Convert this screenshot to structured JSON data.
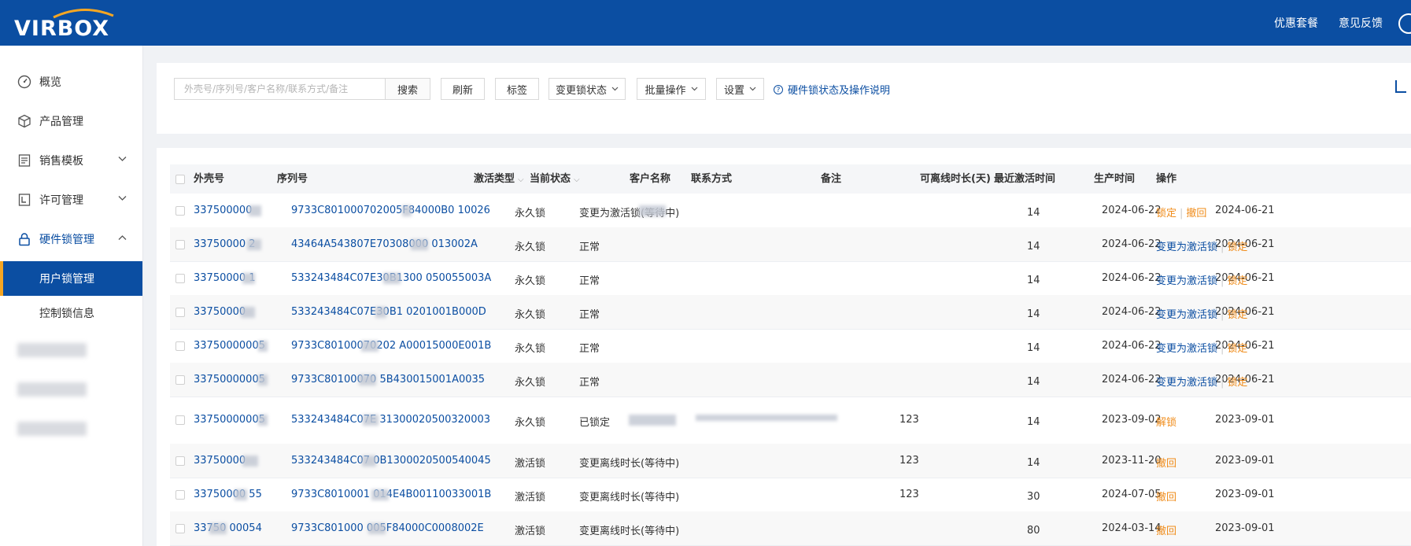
{
  "header": {
    "logo": "VIRBOX",
    "links": [
      "优惠套餐",
      "意见反馈"
    ]
  },
  "sidebar": {
    "items": [
      {
        "label": "概览",
        "icon": "dashboard-icon"
      },
      {
        "label": "产品管理",
        "icon": "cube-icon"
      },
      {
        "label": "销售模板",
        "icon": "template-icon"
      },
      {
        "label": "许可管理",
        "icon": "license-icon"
      },
      {
        "label": "硬件锁管理",
        "icon": "lock-icon"
      }
    ],
    "submenu": [
      "用户锁管理",
      "控制锁信息"
    ]
  },
  "toolbar": {
    "search_placeholder": "外壳号/序列号/客户名称/联系方式/备注",
    "search_btn": "搜索",
    "refresh_btn": "刷新",
    "tag_btn": "标签",
    "change_state_btn": "变更锁状态",
    "batch_btn": "批量操作",
    "settings_btn": "设置",
    "help_link": "硬件锁状态及操作说明"
  },
  "table": {
    "headers": {
      "shell": "外壳号",
      "serial": "序列号",
      "type": "激活类型",
      "state": "当前状态",
      "customer": "客户名称",
      "contact": "联系方式",
      "note": "备注",
      "offline": "可离线时长(天)",
      "last_active": "最近激活时间",
      "produced": "生产时间",
      "ops": "操作"
    },
    "rows": [
      {
        "shell": "337500000",
        "serial": "9733C801000702005F84000B0   10026",
        "type": "永久锁",
        "state": "变更为激活锁(等待中)",
        "note": "",
        "offline": "14",
        "last_active": "2024-06-22",
        "produced": "2024-06-21",
        "op1": "锁定",
        "op2": "撤回",
        "op1_color": "orange",
        "op2_color": "orange"
      },
      {
        "shell": "33750000   2",
        "serial": "43464A543807E70308000    013002A",
        "type": "永久锁",
        "state": "正常",
        "note": "",
        "offline": "14",
        "last_active": "2024-06-22",
        "produced": "2024-06-21",
        "op1": "变更为激活锁",
        "op2": "锁定",
        "op1_color": "link",
        "op2_color": "orange"
      },
      {
        "shell": "33750000   1",
        "serial": "533243484C07E30B1300   050055003A",
        "type": "永久锁",
        "state": "正常",
        "note": "",
        "offline": "14",
        "last_active": "2024-06-22",
        "produced": "2024-06-21",
        "op1": "变更为激活锁",
        "op2": "锁定",
        "op1_color": "link",
        "op2_color": "orange"
      },
      {
        "shell": "33750000",
        "serial": "533243484C07E30B1   0201001B000D",
        "type": "永久锁",
        "state": "正常",
        "note": "",
        "offline": "14",
        "last_active": "2024-06-22",
        "produced": "2024-06-21",
        "op1": "变更为激活锁",
        "op2": "锁定",
        "op1_color": "link",
        "op2_color": "orange"
      },
      {
        "shell": "33750000005",
        "serial": "9733C80100070202   A00015000E001B",
        "type": "永久锁",
        "state": "正常",
        "note": "",
        "offline": "14",
        "last_active": "2024-06-22",
        "produced": "2024-06-21",
        "op1": "变更为激活锁",
        "op2": "锁定",
        "op1_color": "link",
        "op2_color": "orange"
      },
      {
        "shell": "33750000005",
        "serial": "9733C80100070   5B430015001A0035",
        "type": "永久锁",
        "state": "正常",
        "note": "",
        "offline": "14",
        "last_active": "2024-06-22",
        "produced": "2024-06-21",
        "op1": "变更为激活锁",
        "op2": "锁定",
        "op1_color": "link",
        "op2_color": "orange"
      },
      {
        "shell": "33750000005",
        "serial": "533243484C07E   31300020500320003",
        "type": "永久锁",
        "state": "已锁定",
        "note": "123",
        "offline": "14",
        "last_active": "2023-09-02",
        "produced": "2023-09-01",
        "op1": "解锁",
        "op2": "",
        "op1_color": "orange",
        "op2_color": "orange"
      },
      {
        "shell": "33750000",
        "serial": "533243484C07   0B1300020500540045",
        "type": "激活锁",
        "state": "变更离线时长(等待中)",
        "note": "123",
        "offline": "14",
        "last_active": "2023-11-20",
        "produced": "2023-09-01",
        "op1": "撤回",
        "op2": "",
        "op1_color": "orange",
        "op2_color": "orange"
      },
      {
        "shell": "33750000   55",
        "serial": "9733C8010001   014E4B00110033001B",
        "type": "激活锁",
        "state": "变更离线时长(等待中)",
        "note": "123",
        "offline": "30",
        "last_active": "2024-07-05",
        "produced": "2023-09-01",
        "op1": "撤回",
        "op2": "",
        "op1_color": "orange",
        "op2_color": "orange"
      },
      {
        "shell": "33750   00054",
        "serial": "9733C801000   005F84000C0008002E",
        "type": "激活锁",
        "state": "变更离线时长(等待中)",
        "note": "",
        "offline": "80",
        "last_active": "2024-03-14",
        "produced": "2023-09-01",
        "op1": "撤回",
        "op2": "",
        "op1_color": "orange",
        "op2_color": "orange"
      }
    ]
  },
  "colors": {
    "brand": "#0b4ea2",
    "warn": "#f08c1a"
  }
}
